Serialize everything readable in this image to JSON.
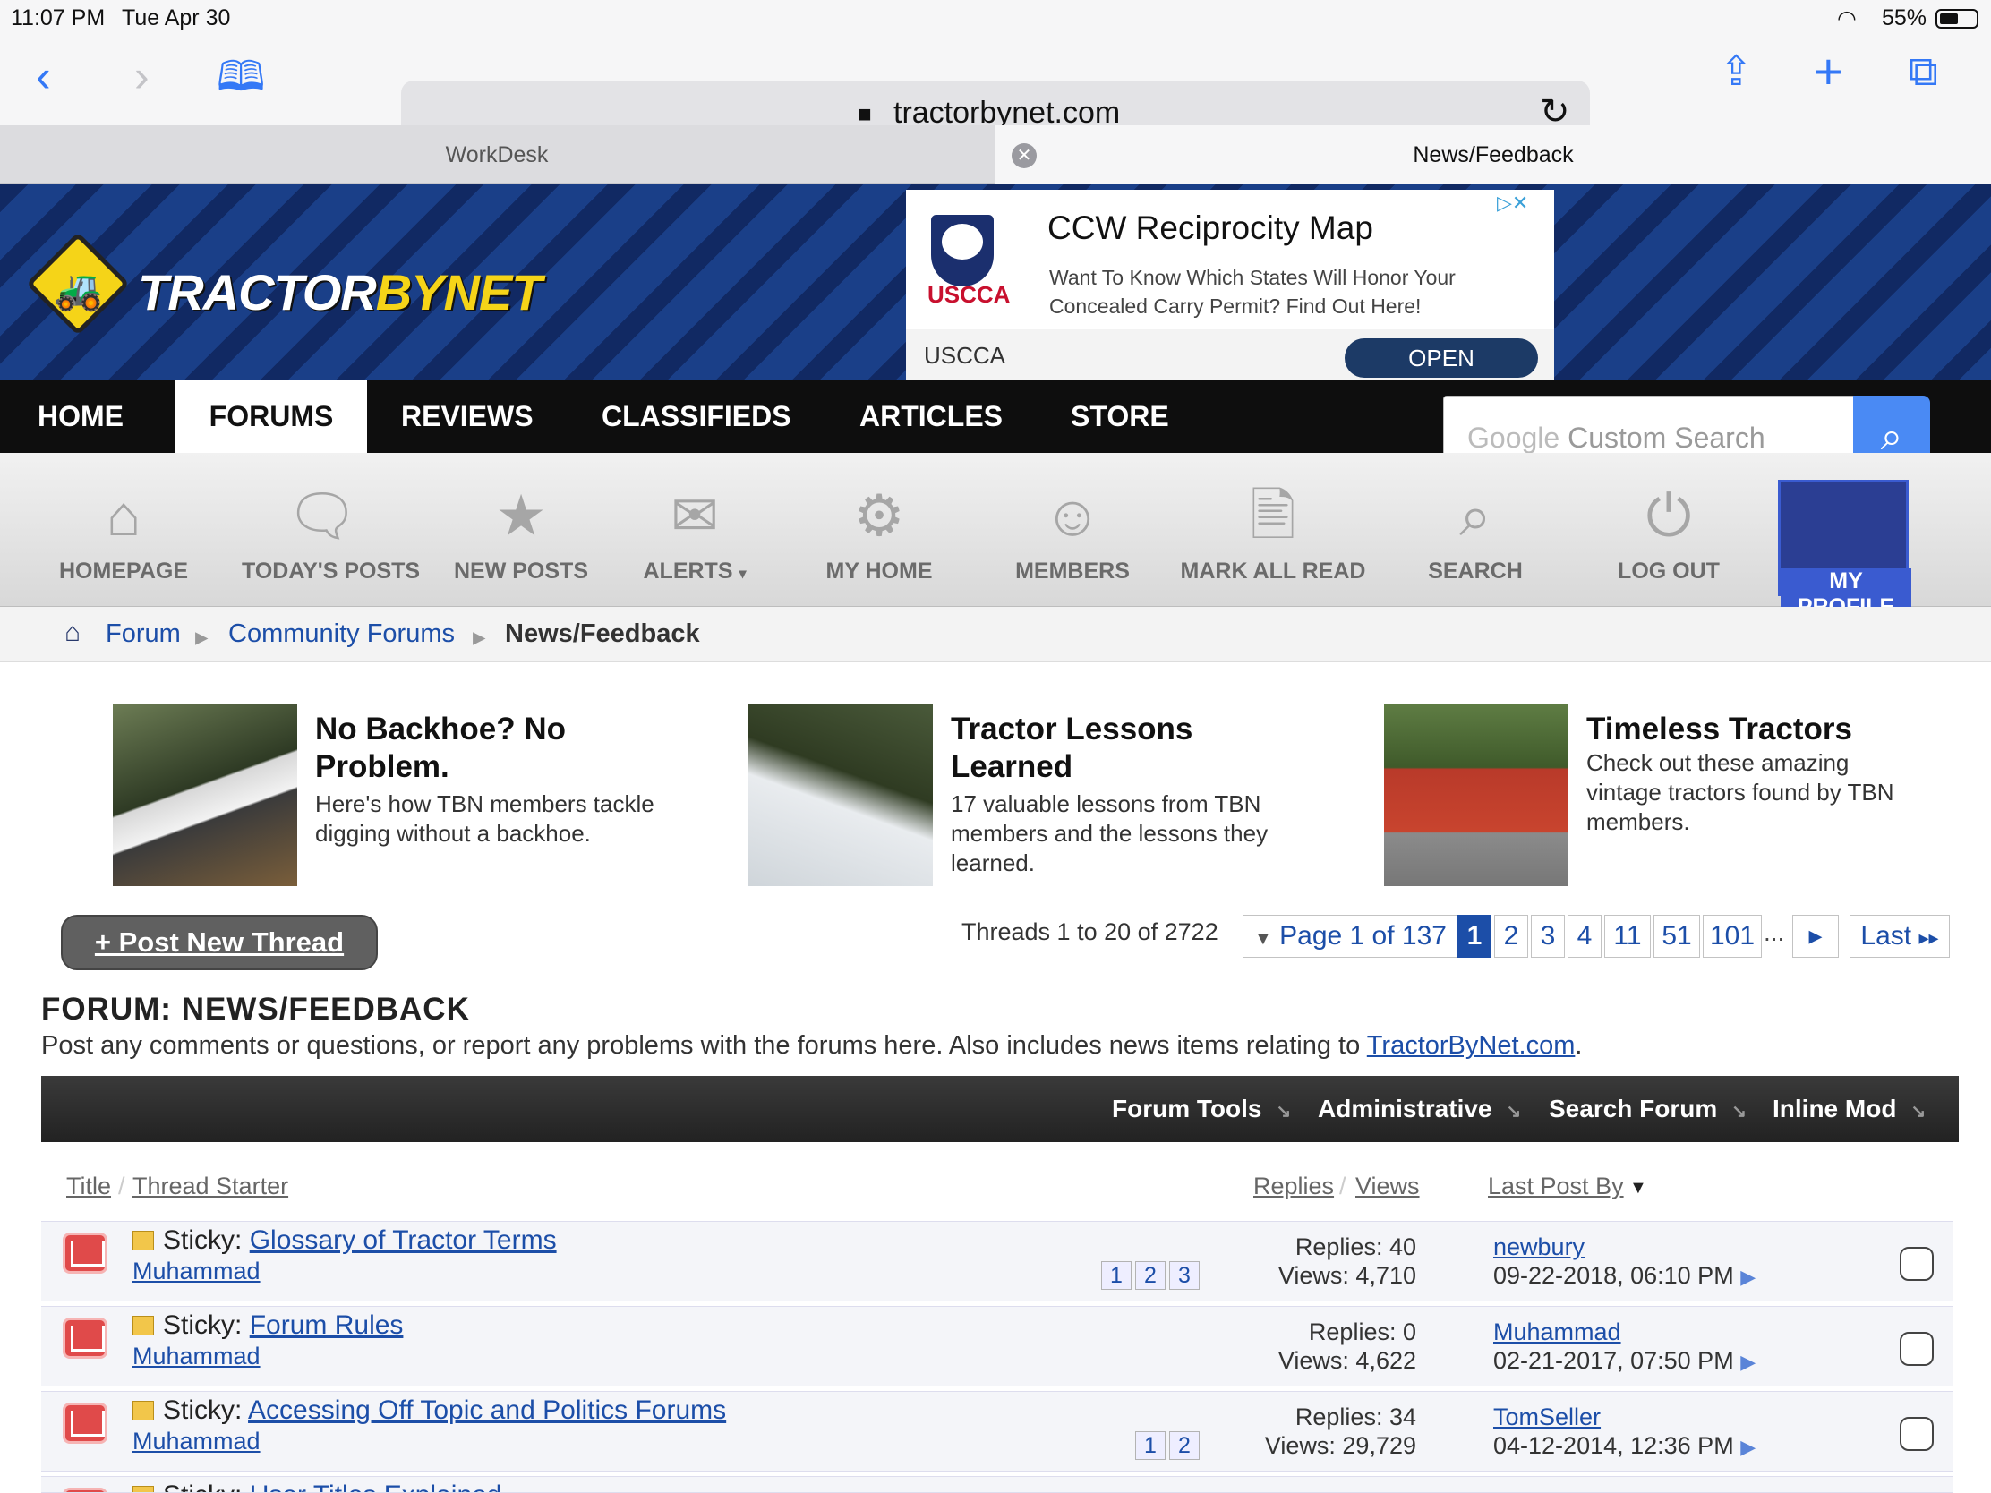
{
  "status": {
    "time": "11:07 PM",
    "date": "Tue Apr 30",
    "wifi_icon": "wifi-icon",
    "battery": "55%"
  },
  "browser": {
    "url": "tractorbynet.com",
    "tabs": [
      {
        "label": "WorkDesk"
      },
      {
        "label": "News/Feedback"
      }
    ]
  },
  "site": {
    "logo_a": "TRACTOR",
    "logo_b": "BYNET"
  },
  "ad": {
    "title": "CCW Reciprocity Map",
    "desc": "Want To Know Which States Will Honor Your Concealed Carry Permit? Find Out Here!",
    "logo": "USCCA",
    "brand": "USCCA",
    "cta": "OPEN"
  },
  "nav": {
    "items": [
      {
        "label": "HOME"
      },
      {
        "label": "FORUMS"
      },
      {
        "label": "REVIEWS"
      },
      {
        "label": "CLASSIFIEDS"
      },
      {
        "label": "ARTICLES"
      },
      {
        "label": "STORE"
      }
    ]
  },
  "search": {
    "google": "Google",
    "placeholder": "Custom Search"
  },
  "subnav": {
    "items": [
      {
        "label": "HOMEPAGE",
        "icon": "home-icon"
      },
      {
        "label": "TODAY'S POSTS",
        "icon": "chat-bubbles-icon"
      },
      {
        "label": "NEW POSTS",
        "icon": "star-bubble-icon"
      },
      {
        "label": "ALERTS",
        "icon": "envelope-icon"
      },
      {
        "label": "MY HOME",
        "icon": "gear-icon"
      },
      {
        "label": "MEMBERS",
        "icon": "users-icon"
      },
      {
        "label": "MARK ALL READ",
        "icon": "document-check-icon"
      },
      {
        "label": "SEARCH",
        "icon": "search-icon"
      },
      {
        "label": "LOG OUT",
        "icon": "power-icon"
      },
      {
        "label": "MY PROFILE",
        "icon": "avatar"
      }
    ]
  },
  "breadcrumb": {
    "items": [
      "Forum",
      "Community Forums",
      "News/Feedback"
    ]
  },
  "promos": [
    {
      "title": "No Backhoe? No Problem.",
      "text": "Here's how TBN members tackle digging without a backhoe."
    },
    {
      "title": "Tractor Lessons Learned",
      "text": "17 valuable lessons from TBN members and the lessons they learned."
    },
    {
      "title": "Timeless Tractors",
      "text": "Check out these amazing vintage tractors found by TBN members."
    }
  ],
  "post_thread": "+ Post New Thread",
  "threads_count": "Threads 1 to 20 of 2722",
  "pagination": {
    "label": "Page 1 of 137",
    "pages": [
      "1",
      "2",
      "3",
      "4",
      "11",
      "51",
      "101"
    ],
    "ellipsis": "...",
    "last": "Last"
  },
  "forum": {
    "title": "FORUM: NEWS/FEEDBACK",
    "desc": "Post any comments or questions, or report any problems with the forums here. Also includes news items relating to ",
    "link": "TractorByNet.com",
    "desc_end": "."
  },
  "tools": [
    "Forum Tools",
    "Administrative",
    "Search Forum",
    "Inline Mod"
  ],
  "columns": {
    "title": "Title",
    "starter": "Thread Starter",
    "replies": "Replies",
    "views": "Views",
    "lastpost": "Last Post By"
  },
  "threads": [
    {
      "prefix": "Sticky:",
      "title": "Glossary of Tractor Terms",
      "starter": "Muhammad",
      "pages": [
        "1",
        "2",
        "3"
      ],
      "replies": "Replies: 40",
      "views": "Views: 4,710",
      "last_user": "newbury",
      "last_date": "09-22-2018, 06:10 PM"
    },
    {
      "prefix": "Sticky:",
      "title": "Forum Rules",
      "starter": "Muhammad",
      "pages": [],
      "replies": "Replies: 0",
      "views": "Views: 4,622",
      "last_user": "Muhammad",
      "last_date": "02-21-2017, 07:50 PM"
    },
    {
      "prefix": "Sticky:",
      "title": "Accessing Off Topic and Politics Forums",
      "starter": "Muhammad",
      "pages": [
        "1",
        "2"
      ],
      "replies": "Replies: 34",
      "views": "Views: 29,729",
      "last_user": "TomSeller",
      "last_date": "04-12-2014, 12:36 PM"
    },
    {
      "prefix": "Sticky:",
      "title": "User Titles Explained"
    }
  ]
}
